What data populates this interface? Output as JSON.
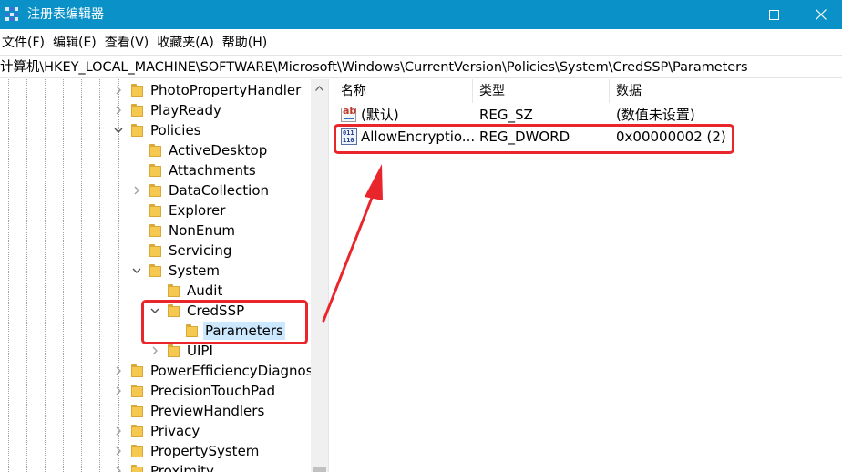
{
  "window": {
    "title": "注册表编辑器",
    "app_icon": "registry-editor-icon"
  },
  "menu": [
    {
      "label": "文件(F)"
    },
    {
      "label": "编辑(E)"
    },
    {
      "label": "查看(V)"
    },
    {
      "label": "收藏夹(A)"
    },
    {
      "label": "帮助(H)"
    }
  ],
  "address": "计算机\\HKEY_LOCAL_MACHINE\\SOFTWARE\\Microsoft\\Windows\\CurrentVersion\\Policies\\System\\CredSSP\\Parameters",
  "tree": {
    "items": [
      {
        "label": "PhotoPropertyHandler",
        "expander": "collapsed"
      },
      {
        "label": "PlayReady",
        "expander": "collapsed"
      },
      {
        "label": "Policies",
        "expander": "expanded"
      },
      {
        "label": "ActiveDesktop",
        "expander": "none"
      },
      {
        "label": "Attachments",
        "expander": "none"
      },
      {
        "label": "DataCollection",
        "expander": "collapsed"
      },
      {
        "label": "Explorer",
        "expander": "none"
      },
      {
        "label": "NonEnum",
        "expander": "none"
      },
      {
        "label": "Servicing",
        "expander": "none"
      },
      {
        "label": "System",
        "expander": "expanded"
      },
      {
        "label": "Audit",
        "expander": "none"
      },
      {
        "label": "CredSSP",
        "expander": "expanded"
      },
      {
        "label": "Parameters",
        "expander": "none",
        "selected": true
      },
      {
        "label": "UIPI",
        "expander": "collapsed"
      },
      {
        "label": "PowerEfficiencyDiagnost",
        "expander": "collapsed"
      },
      {
        "label": "PrecisionTouchPad",
        "expander": "collapsed"
      },
      {
        "label": "PreviewHandlers",
        "expander": "none"
      },
      {
        "label": "Privacy",
        "expander": "collapsed"
      },
      {
        "label": "PropertySystem",
        "expander": "collapsed"
      },
      {
        "label": "Proximity",
        "expander": "collapsed"
      }
    ]
  },
  "list": {
    "columns": {
      "name": "名称",
      "type": "类型",
      "data": "数据"
    },
    "rows": [
      {
        "name": "(默认)",
        "type": "REG_SZ",
        "data": "(数值未设置)",
        "icon": "string-value-icon"
      },
      {
        "name": "AllowEncryptio...",
        "type": "REG_DWORD",
        "data": "0x00000002 (2)",
        "icon": "binary-value-icon"
      }
    ]
  },
  "colors": {
    "titlebar": "#0a91c8",
    "annotation": "#e8262b",
    "selection": "#cce8ff",
    "folder": "#f5c94f"
  }
}
